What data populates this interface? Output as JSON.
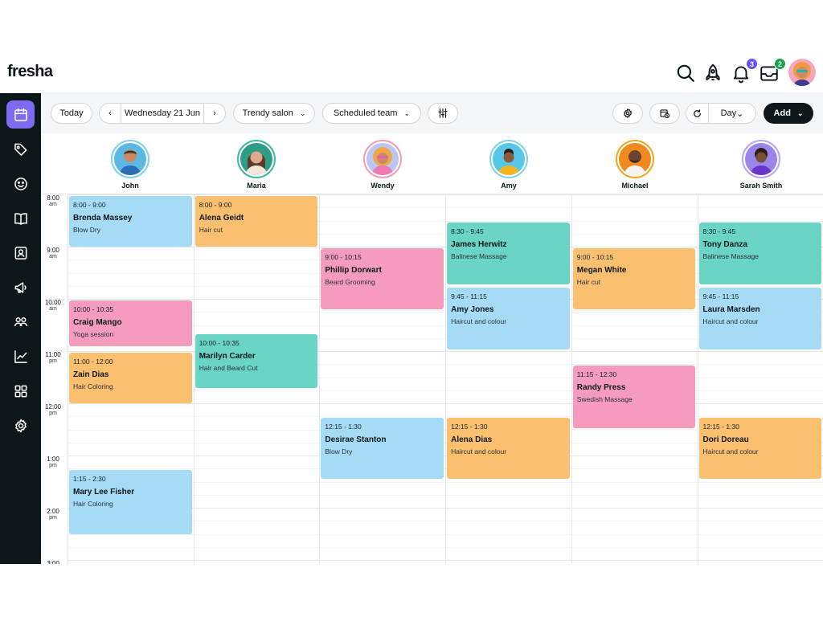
{
  "app": {
    "logo": "fresha"
  },
  "topbar": {
    "notifications_count": "3",
    "calendar_count": "2",
    "colors": {
      "notification_badge": "#6950f3",
      "calendar_badge": "#1aa34a"
    }
  },
  "sidebar": {
    "items": [
      {
        "icon": "calendar-icon",
        "active": true
      },
      {
        "icon": "tag-icon"
      },
      {
        "icon": "smiley-icon"
      },
      {
        "icon": "book-icon"
      },
      {
        "icon": "contact-card-icon"
      },
      {
        "icon": "megaphone-icon"
      },
      {
        "icon": "team-icon"
      },
      {
        "icon": "chart-icon"
      },
      {
        "icon": "grid-icon"
      },
      {
        "icon": "gear-icon"
      }
    ]
  },
  "toolbar": {
    "today_label": "Today",
    "date_label": "Wednesday 21 Jun",
    "location_label": "Trendy salon",
    "team_label": "Scheduled team",
    "view_label": "Day",
    "add_label": "Add"
  },
  "staff": [
    {
      "name": "John",
      "ring": "#7fd3e6"
    },
    {
      "name": "Maria",
      "ring": "#3fb8a0"
    },
    {
      "name": "Wendy",
      "ring": "#f49ab9"
    },
    {
      "name": "Amy",
      "ring": "#7fd3e6"
    },
    {
      "name": "Michael",
      "ring": "#f5a623"
    },
    {
      "name": "Sarah Smith",
      "ring": "#b7a5f5"
    }
  ],
  "times": [
    {
      "t": "8:00",
      "ampm": "am"
    },
    {
      "t": "9:00",
      "ampm": "am"
    },
    {
      "t": "10:00",
      "ampm": "am"
    },
    {
      "t": "11:00",
      "ampm": "pm"
    },
    {
      "t": "12:00",
      "ampm": "pm"
    },
    {
      "t": "1:00",
      "ampm": "pm"
    },
    {
      "t": "2:00",
      "ampm": "pm"
    },
    {
      "t": "3:00",
      "ampm": ""
    }
  ],
  "colors": {
    "blue": "#a5dbf5",
    "orange": "#fbbf70",
    "pink": "#f59bbd",
    "teal": "#6ad4c5",
    "accent": "#7c6cf2"
  },
  "appointments": [
    {
      "col": 0,
      "start": 8.0,
      "end": 9.0,
      "time": "8:00 - 9:00",
      "client": "Brenda Massey",
      "service": "Blow Dry",
      "color": "blue"
    },
    {
      "col": 0,
      "start": 10.0,
      "end": 10.9,
      "time": "10:00 - 10:35",
      "client": "Craig Mango",
      "service": "Yoga session",
      "color": "pink"
    },
    {
      "col": 0,
      "start": 11.0,
      "end": 12.0,
      "time": "11:00 - 12:00",
      "client": "Zain Dias",
      "service": "Hair Coloring",
      "color": "orange"
    },
    {
      "col": 0,
      "start": 13.25,
      "end": 14.5,
      "time": "1:15 - 2:30",
      "client": "Mary Lee Fisher",
      "service": "Hair Coloring",
      "color": "blue"
    },
    {
      "col": 1,
      "start": 8.0,
      "end": 9.0,
      "time": "8:00 - 9:00",
      "client": "Alena Geidt",
      "service": "Hair cut",
      "color": "orange"
    },
    {
      "col": 1,
      "start": 10.65,
      "end": 11.7,
      "time": "10:00 - 10:35",
      "client": "Marilyn Carder",
      "service": "Hair and Beard Cut",
      "color": "teal"
    },
    {
      "col": 2,
      "start": 9.0,
      "end": 10.2,
      "time": "9:00 - 10:15",
      "client": "Phillip Dorwart",
      "service": "Beard Grooming",
      "color": "pink"
    },
    {
      "col": 2,
      "start": 12.25,
      "end": 13.45,
      "time": "12:15 - 1:30",
      "client": "Desirae Stanton",
      "service": "Blow Dry",
      "color": "blue"
    },
    {
      "col": 3,
      "start": 8.5,
      "end": 9.72,
      "time": "8:30 - 9:45",
      "client": "James Herwitz",
      "service": "Balinese Massage",
      "color": "teal"
    },
    {
      "col": 3,
      "start": 9.75,
      "end": 10.97,
      "time": "9:45 - 11:15",
      "client": "Amy Jones",
      "service": "Haircut and colour",
      "color": "blue"
    },
    {
      "col": 3,
      "start": 12.25,
      "end": 13.45,
      "time": "12:15 - 1:30",
      "client": "Alena Dias",
      "service": "Haircut and colour",
      "color": "orange"
    },
    {
      "col": 4,
      "start": 9.0,
      "end": 10.2,
      "time": "9:00 - 10:15",
      "client": "Megan White",
      "service": "Hair cut",
      "color": "orange"
    },
    {
      "col": 4,
      "start": 11.25,
      "end": 12.47,
      "time": "11:15 - 12:30",
      "client": "Randy Press",
      "service": "Swedish Massage",
      "color": "pink"
    },
    {
      "col": 5,
      "start": 8.5,
      "end": 9.72,
      "time": "8:30 - 9:45",
      "client": "Tony Danza",
      "service": "Balinese Massage",
      "color": "teal"
    },
    {
      "col": 5,
      "start": 9.75,
      "end": 10.97,
      "time": "9:45 - 11:15",
      "client": "Laura Marsden",
      "service": "Haircut and colour",
      "color": "blue"
    },
    {
      "col": 5,
      "start": 12.25,
      "end": 13.45,
      "time": "12:15 - 1:30",
      "client": "Dori Doreau",
      "service": "Haircut and colour",
      "color": "orange"
    }
  ]
}
